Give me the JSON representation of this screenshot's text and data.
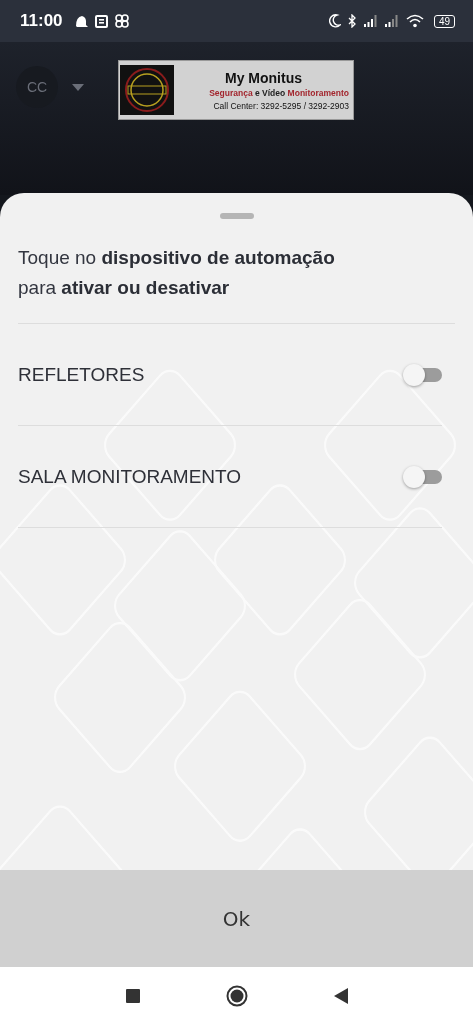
{
  "status_bar": {
    "time": "11:00",
    "battery": "49"
  },
  "header": {
    "account": "CC",
    "logo": {
      "title": "My Monitus",
      "subtitle": [
        {
          "text": "Segurança",
          "color": "#a3262e"
        },
        {
          "text": "e Vídeo",
          "color": "#222222"
        },
        {
          "text": "Monitoramento",
          "color": "#a3262e"
        }
      ],
      "contact": "Call Center: 3292-5295 / 3292-2903"
    }
  },
  "sheet": {
    "prompt_lines": [
      "Toque no **dispositivo de automação**",
      "para **ativar ou desativar**"
    ],
    "devices": [
      {
        "name": "REFLETORES",
        "on": false
      },
      {
        "name": "SALA MONITORAMENTO",
        "on": false
      }
    ],
    "button": "Ok"
  }
}
